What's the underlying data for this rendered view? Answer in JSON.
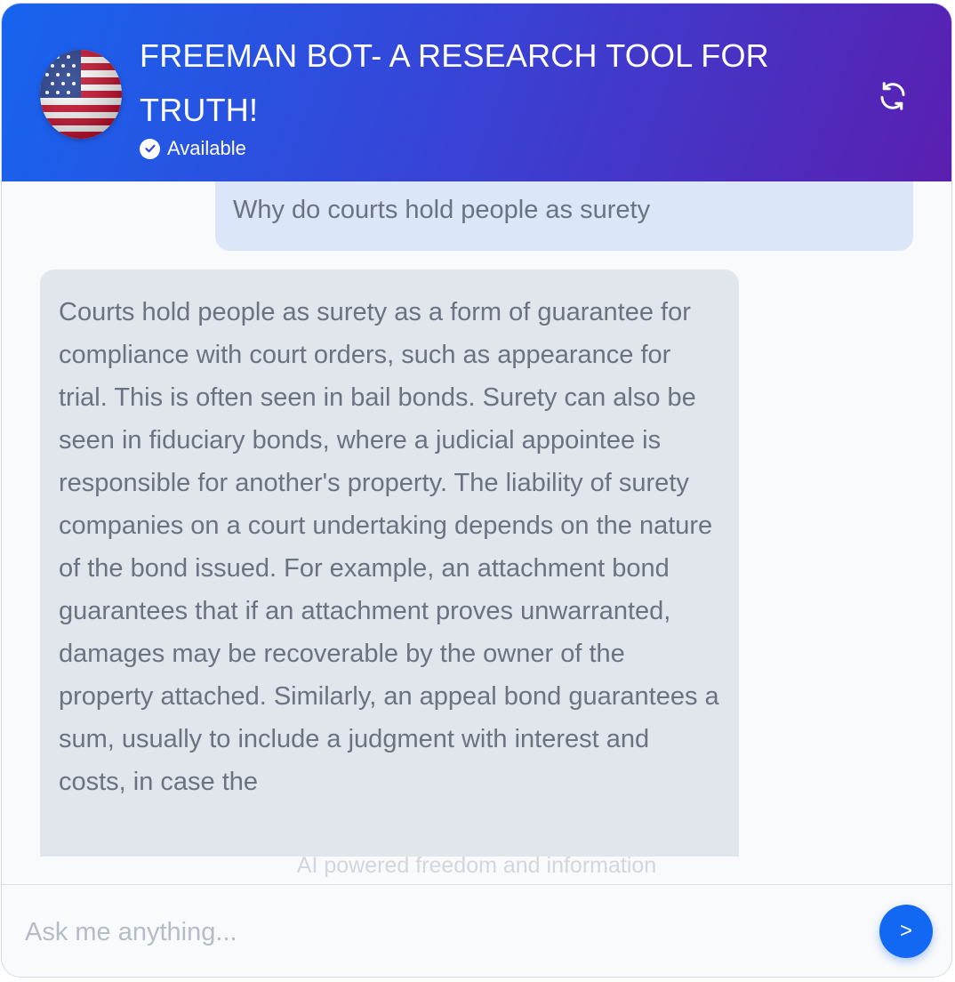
{
  "header": {
    "title": "FREEMAN BOT- A RESEARCH TOOL FOR TRUTH!",
    "status": "Available",
    "avatar_icon": "us-flag-icon",
    "refresh_icon": "refresh-icon",
    "status_icon": "check-circle-icon"
  },
  "colors": {
    "header_gradient_start": "#1764ee",
    "header_gradient_end": "#5a1fb0",
    "user_bubble": "#dbe7f8",
    "bot_bubble": "#e1e5ec",
    "send_button": "#1368f3"
  },
  "messages": [
    {
      "role": "user",
      "text": "Why do courts hold people as surety"
    },
    {
      "role": "bot",
      "text": "Courts hold people as surety as a form of guarantee for compliance with court orders, such as appearance for trial. This is often seen in bail bonds. Surety can also be seen in fiduciary bonds, where a judicial appointee is responsible for another's property. The liability of surety companies on a court undertaking depends on the nature of the bond issued. For example, an attachment bond guarantees that if an attachment proves unwarranted, damages may be recoverable by the owner of the property attached. Similarly, an appeal bond guarantees a sum, usually to include a judgment with interest and costs, in case the"
    }
  ],
  "footer_note": "AI powered freedom and information",
  "input": {
    "placeholder": "Ask me anything...",
    "value": ""
  },
  "send_button_label": ">"
}
